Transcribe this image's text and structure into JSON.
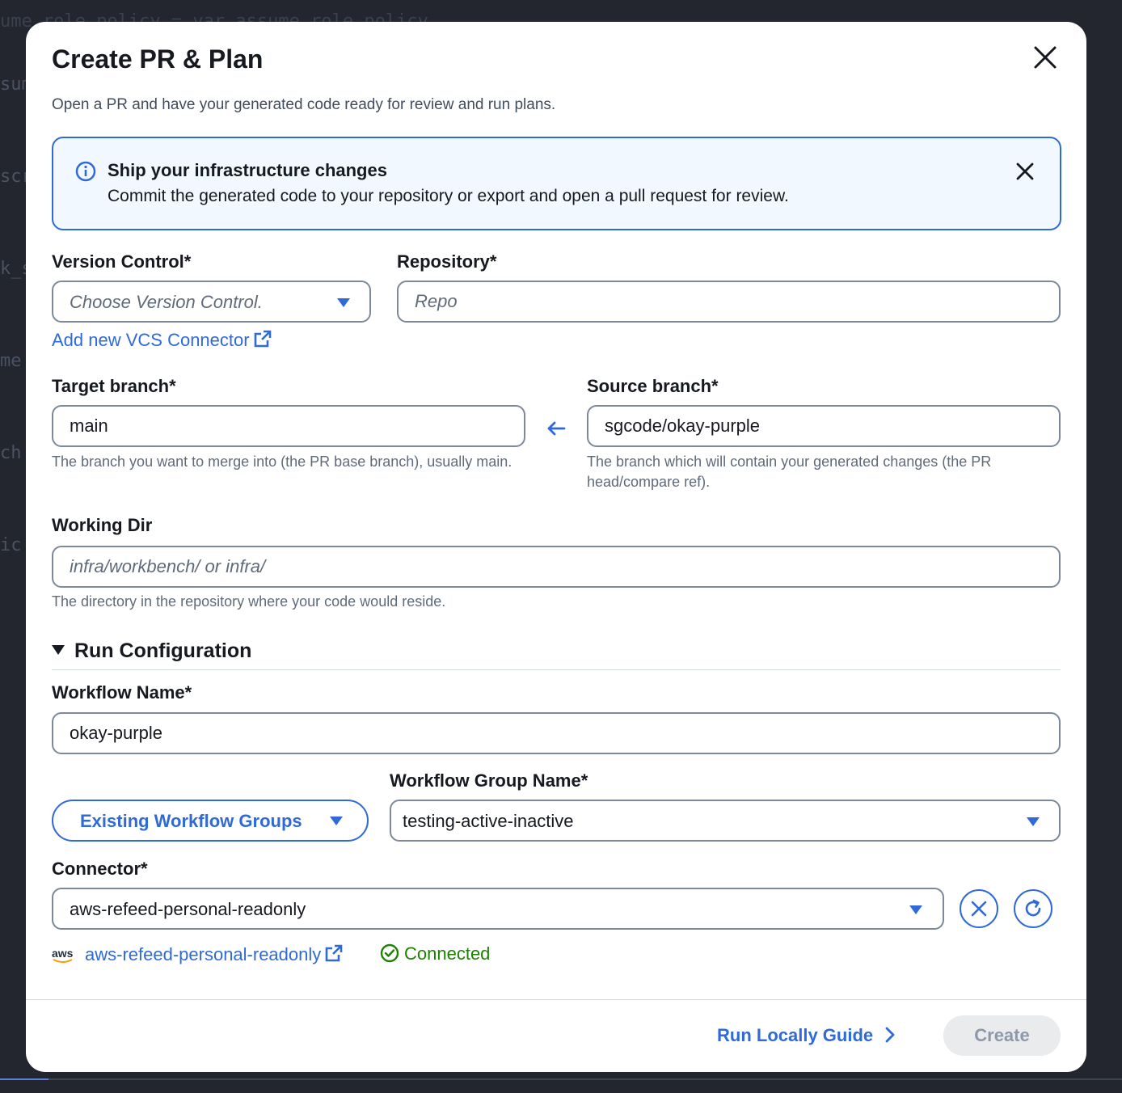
{
  "background": {
    "code_fragments": [
      "sume",
      "scr",
      "k_s",
      "me",
      "ch",
      "ic"
    ],
    "top_line": "ume_role_policy = var.assume_role_policy"
  },
  "modal": {
    "title": "Create PR & Plan",
    "subtitle": "Open a PR and have your generated code ready for review and run plans."
  },
  "info_alert": {
    "title": "Ship your infrastructure changes",
    "body": "Commit the generated code to your repository or export and open a pull request for review."
  },
  "version_control": {
    "label": "Version Control*",
    "placeholder": "Choose Version Control.",
    "add_link": "Add new VCS Connector"
  },
  "repository": {
    "label": "Repository*",
    "placeholder": "Repo"
  },
  "target_branch": {
    "label": "Target branch*",
    "value": "main",
    "hint": "The branch you want to merge into (the PR base branch), usually main."
  },
  "source_branch": {
    "label": "Source branch*",
    "value": "sgcode/okay-purple",
    "hint": "The branch which will contain your generated changes (the PR head/compare ref)."
  },
  "working_dir": {
    "label": "Working Dir",
    "placeholder": "infra/workbench/ or infra/",
    "hint": "The directory in the repository where your code would reside."
  },
  "run_configuration": {
    "title": "Run Configuration",
    "workflow_name_label": "Workflow Name*",
    "workflow_name_value": "okay-purple",
    "group_mode_button": "Existing Workflow Groups",
    "workflow_group_label": "Workflow Group Name*",
    "workflow_group_value": "testing-active-inactive",
    "connector_label": "Connector*",
    "connector_value": "aws-refeed-personal-readonly",
    "connector_logo_text": "aws",
    "connector_link": "aws-refeed-personal-readonly",
    "connector_status": "Connected"
  },
  "footer": {
    "run_locally": "Run Locally Guide",
    "create": "Create"
  },
  "colors": {
    "accent": "#2f6ad8",
    "success": "#1d8102",
    "info_bg": "#f1f8ff",
    "disabled_bg": "#e9ebed"
  }
}
